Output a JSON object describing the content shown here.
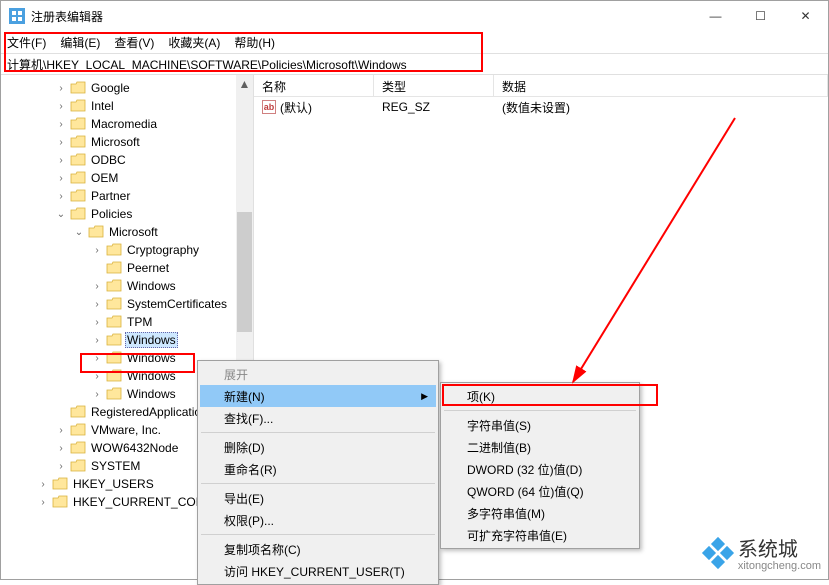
{
  "window": {
    "title": "注册表编辑器",
    "minimize": "—",
    "maximize": "☐",
    "close": "✕"
  },
  "menubar": {
    "file": "文件(F)",
    "edit": "编辑(E)",
    "view": "查看(V)",
    "fav": "收藏夹(A)",
    "help": "帮助(H)"
  },
  "address": "计算机\\HKEY_LOCAL_MACHINE\\SOFTWARE\\Policies\\Microsoft\\Windows",
  "tree": [
    {
      "label": "Google",
      "indent": "indent-1",
      "exp": ">"
    },
    {
      "label": "Intel",
      "indent": "indent-1",
      "exp": ">"
    },
    {
      "label": "Macromedia",
      "indent": "indent-1",
      "exp": ">"
    },
    {
      "label": "Microsoft",
      "indent": "indent-1",
      "exp": ">"
    },
    {
      "label": "ODBC",
      "indent": "indent-1",
      "exp": ">"
    },
    {
      "label": "OEM",
      "indent": "indent-1",
      "exp": ">"
    },
    {
      "label": "Partner",
      "indent": "indent-1",
      "exp": ">"
    },
    {
      "label": "Policies",
      "indent": "indent-1",
      "exp": "v"
    },
    {
      "label": "Microsoft",
      "indent": "indent-2",
      "exp": "v"
    },
    {
      "label": "Cryptography",
      "indent": "indent-3",
      "exp": ">"
    },
    {
      "label": "Peernet",
      "indent": "indent-3",
      "exp": ""
    },
    {
      "label": "Windows",
      "indent": "indent-3",
      "exp": ">"
    },
    {
      "label": "SystemCertificates",
      "indent": "indent-3",
      "exp": ">"
    },
    {
      "label": "TPM",
      "indent": "indent-3",
      "exp": ">"
    },
    {
      "label": "Windows",
      "indent": "indent-3",
      "exp": ">",
      "selected": true
    },
    {
      "label": "Windows",
      "indent": "indent-3",
      "exp": ">"
    },
    {
      "label": "Windows",
      "indent": "indent-3",
      "exp": ">"
    },
    {
      "label": "Windows",
      "indent": "indent-3",
      "exp": ">"
    },
    {
      "label": "RegisteredApplications",
      "indent": "indent-1",
      "exp": ""
    },
    {
      "label": "VMware, Inc.",
      "indent": "indent-1",
      "exp": ">"
    },
    {
      "label": "WOW6432Node",
      "indent": "indent-1",
      "exp": ">"
    },
    {
      "label": "SYSTEM",
      "indent": "root-1",
      "exp": ">"
    },
    {
      "label": "HKEY_USERS",
      "indent": "root-1",
      "exp": ">",
      "rootshift": true
    },
    {
      "label": "HKEY_CURRENT_CONFIG",
      "indent": "root-1",
      "exp": ">",
      "rootshift": true
    }
  ],
  "list": {
    "headers": {
      "name": "名称",
      "type": "类型",
      "data": "数据"
    },
    "rows": [
      {
        "name": "(默认)",
        "type": "REG_SZ",
        "data": "(数值未设置)"
      }
    ]
  },
  "context_main": {
    "expand": "展开",
    "new": "新建(N)",
    "find": "查找(F)...",
    "delete": "删除(D)",
    "rename": "重命名(R)",
    "export": "导出(E)",
    "perm": "权限(P)...",
    "copyname": "复制项名称(C)",
    "goto": "访问 HKEY_CURRENT_USER(T)"
  },
  "context_sub": {
    "key": "项(K)",
    "string": "字符串值(S)",
    "binary": "二进制值(B)",
    "dword": "DWORD (32 位)值(D)",
    "qword": "QWORD (64 位)值(Q)",
    "multi": "多字符串值(M)",
    "expand": "可扩充字符串值(E)"
  },
  "watermark": {
    "name": "系统城",
    "url": "xitongcheng.com"
  }
}
